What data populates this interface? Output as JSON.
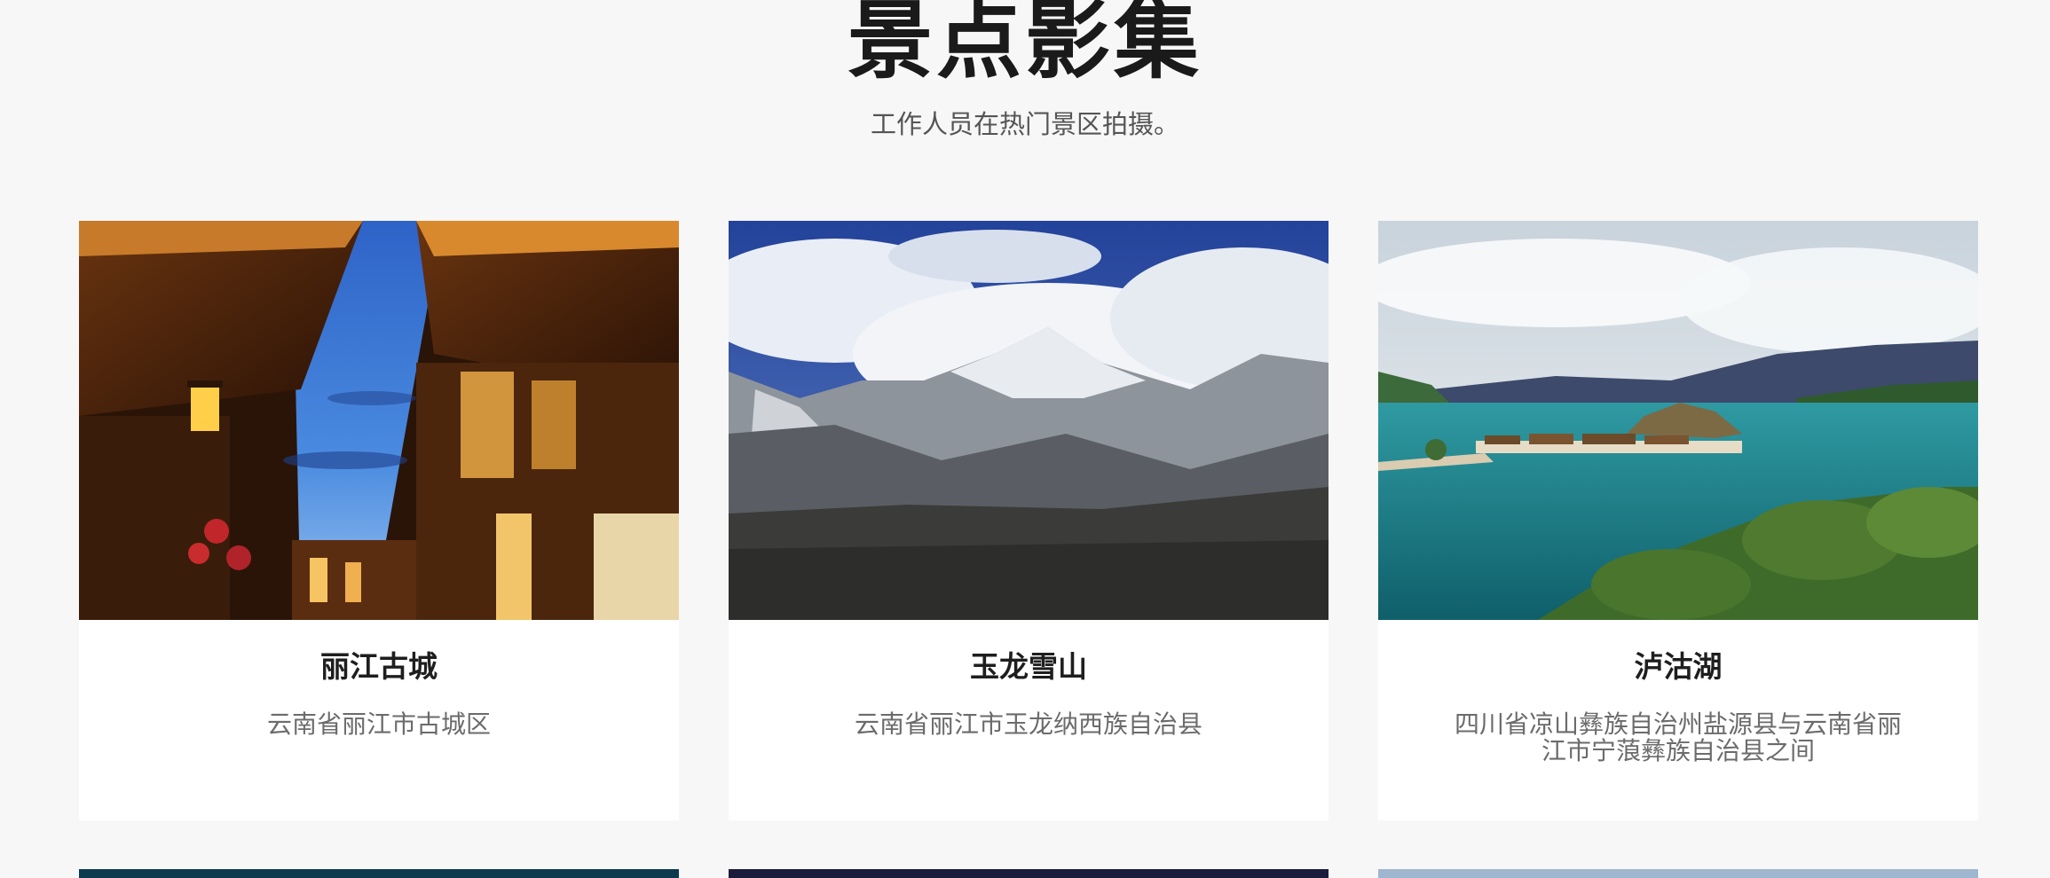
{
  "section": {
    "title": "景点影集",
    "subtitle": "工作人员在热门景区拍摄。"
  },
  "cards": [
    {
      "title": "丽江古城",
      "location": "云南省丽江市古城区",
      "image_icon": "old-town-photo"
    },
    {
      "title": "玉龙雪山",
      "location": "云南省丽江市玉龙纳西族自治县",
      "image_icon": "snow-mountain-photo"
    },
    {
      "title": "泸沽湖",
      "location": "四川省凉山彝族自治州盐源县与云南省丽江市宁蒗彝族自治县之间",
      "image_icon": "lake-photo"
    }
  ],
  "colors": {
    "background": "#f7f7f7",
    "card": "#ffffff",
    "title_text": "#1e1e1e",
    "muted_text": "#6b6b6b"
  }
}
